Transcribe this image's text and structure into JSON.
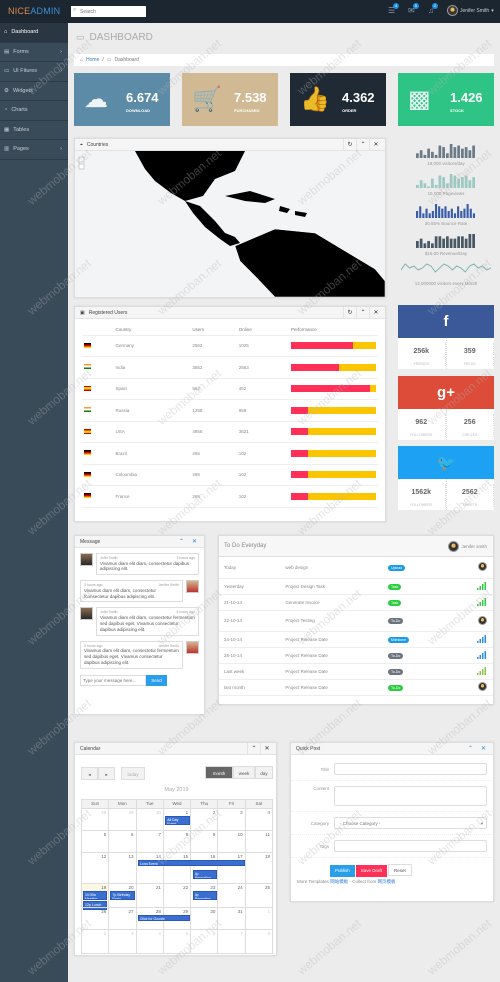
{
  "header": {
    "logo_a": "NICE",
    "logo_b": "ADMIN",
    "search_placeholder": "Search",
    "badges": [
      "4",
      "5",
      "2"
    ],
    "user": "Jenifer Smith"
  },
  "sidebar": {
    "items": [
      {
        "label": "Dashboard",
        "icon": "home-icon",
        "active": true
      },
      {
        "label": "Forms",
        "icon": "document-icon",
        "chevron": true
      },
      {
        "label": "UI Fitures",
        "icon": "monitor-icon",
        "chevron": true
      },
      {
        "label": "Widgets",
        "icon": "gear-icon"
      },
      {
        "label": "Charts",
        "icon": "pie-icon"
      },
      {
        "label": "Tables",
        "icon": "table-icon"
      },
      {
        "label": "Pages",
        "icon": "page-icon",
        "chevron": true
      }
    ]
  },
  "page": {
    "title": "DASHBOARD",
    "breadcrumb": [
      "Home",
      "Dashboard"
    ]
  },
  "stats": [
    {
      "value": "6.674",
      "label": "DOWNLOAD",
      "color": "#5b8ba6",
      "icon": "cloud-download-icon"
    },
    {
      "value": "7.538",
      "label": "PURCHASED",
      "color": "#d1b993",
      "icon": "cart-icon"
    },
    {
      "value": "4.362",
      "label": "ORDER",
      "color": "#1f2a35",
      "icon": "thumbs-up-icon"
    },
    {
      "value": "1.426",
      "label": "STOCK",
      "color": "#2ec486",
      "icon": "cubes-icon"
    }
  ],
  "countries_panel": {
    "title": "Countries"
  },
  "sparklines": [
    {
      "label": "19,000 visitors/day",
      "color": "#6b7c88",
      "values": [
        3,
        5,
        2,
        6,
        4,
        2,
        8,
        7,
        3,
        9,
        7,
        8,
        6,
        7,
        5,
        8
      ]
    },
    {
      "label": "15,000 Pageviews",
      "color": "#9cc9c4",
      "values": [
        2,
        5,
        3,
        1,
        6,
        2,
        8,
        7,
        3,
        9,
        8,
        6,
        7,
        8,
        5,
        7
      ]
    },
    {
      "label": "30.55% Bounce Rate",
      "color": "#3b5da8",
      "values": [
        3,
        5,
        2,
        4,
        2,
        3,
        6,
        5,
        4,
        5,
        3,
        4,
        2,
        5,
        3,
        4,
        6,
        4,
        2
      ]
    },
    {
      "label": "$16.00 Revenue/Day",
      "color": "#4a5866",
      "values": [
        3,
        4,
        2,
        3,
        2,
        5,
        5,
        4,
        5,
        4,
        4,
        5,
        5,
        4,
        6,
        6
      ]
    },
    {
      "label": "12,000000 visitors every Month",
      "color": "#7fb5b0",
      "values": [
        3,
        6,
        4,
        5,
        3,
        4,
        6,
        5,
        2,
        4,
        6,
        5,
        3,
        5,
        4,
        2,
        5,
        6,
        4,
        5,
        3,
        4
      ]
    }
  ],
  "users_panel": {
    "title": "Registered Users",
    "columns": [
      "Country",
      "Users",
      "Online",
      "Performance"
    ],
    "rows": [
      {
        "flag": "de",
        "country": "Germany",
        "users": "2563",
        "online": "1025",
        "perf": 0.73
      },
      {
        "flag": "in",
        "country": "India",
        "users": "3652",
        "online": "2563",
        "perf": 0.57
      },
      {
        "flag": "es",
        "country": "Spain",
        "users": "562",
        "online": "452",
        "perf": 0.93
      },
      {
        "flag": "in",
        "country": "Russia",
        "users": "1258",
        "online": "958",
        "perf": 0.2
      },
      {
        "flag": "es",
        "country": "USA",
        "users": "4856",
        "online": "3621",
        "perf": 0.2
      },
      {
        "flag": "de",
        "country": "Brazil",
        "users": "265",
        "online": "102",
        "perf": 0.2
      },
      {
        "flag": "de",
        "country": "Coloumbia",
        "users": "265",
        "online": "102",
        "perf": 0.2
      },
      {
        "flag": "de",
        "country": "France",
        "users": "265",
        "online": "102",
        "perf": 0.2
      }
    ]
  },
  "social": [
    {
      "icon": "facebook-icon",
      "glyph": "f",
      "color": "#3b5998",
      "a": "256k",
      "al": "FRIENDS",
      "b": "359",
      "bl": "FEEDS"
    },
    {
      "icon": "google-plus-icon",
      "glyph": "g+",
      "color": "#dd4b39",
      "a": "962",
      "al": "FOLLOWERS",
      "b": "256",
      "bl": "CIRCLES"
    },
    {
      "icon": "twitter-icon",
      "glyph": "🐦",
      "color": "#1da1f2",
      "a": "1562k",
      "al": "FOLLOWERS",
      "b": "2562",
      "bl": "TWEETS"
    }
  ],
  "messages": {
    "title": "Message",
    "items": [
      {
        "side": "left",
        "name": "John Smith",
        "time": "3 hours ago",
        "text": "Vivamus diam elit diam, consectetur dapibus adipiscing elit."
      },
      {
        "side": "right",
        "name": "Jenifer Smith",
        "time": "3 hours ago",
        "text": "Vivamus diam elit diam, consectetur fconsectetur dapibus adipiscing elit."
      },
      {
        "side": "left",
        "name": "John Smith",
        "time": "4 hours ago",
        "text": "Vivamus diam elit diam, consectetur fermentum sed dapibus eget, Vivamus consectetur dapibus adipiscing elit."
      },
      {
        "side": "right",
        "name": "Jenifer Smith",
        "time": "3 hours ago",
        "text": "Vivamus diam elit diam, consectetur fermentum sed dapibus eget, Vivamus consectetur dapibus adipiscing elit."
      }
    ],
    "input_placeholder": "Type your message here...",
    "send": "Send"
  },
  "todo": {
    "title": "To Do Everyday",
    "user": "Jenifer smith",
    "rows": [
      {
        "when": "Today",
        "task": "web design",
        "badge": "Upload",
        "color": "#1a9be6",
        "end": "avatar"
      },
      {
        "when": "Yesterday",
        "task": "Project Design Task",
        "badge": "Task",
        "color": "#2ecc40",
        "end": "green-bars"
      },
      {
        "when": "21-10-14",
        "task": "Generate Invoice",
        "badge": "Task",
        "color": "#2ecc40",
        "end": "green-bars"
      },
      {
        "when": "22-10-14",
        "task": "Project Testing",
        "badge": "To-Do",
        "color": "#6c757d",
        "end": "avatar"
      },
      {
        "when": "24-10-14",
        "task": "Project Release Date",
        "badge": "Milestone",
        "color": "#1a9be6",
        "end": "blue-bars"
      },
      {
        "when": "28-10-14",
        "task": "Project Release Date",
        "badge": "To-Do",
        "color": "#6c757d",
        "end": "blue-bars"
      },
      {
        "when": "Last week",
        "task": "Project Release Date",
        "badge": "To-Do",
        "color": "#6c757d",
        "end": "olive-bars"
      },
      {
        "when": "last month",
        "task": "Project Release Date",
        "badge": "To-Do",
        "color": "#2ecc40",
        "end": "avatar"
      }
    ]
  },
  "calendar": {
    "title": "Calendar",
    "prev": "◂",
    "next": "▸",
    "today": "today",
    "views": [
      "month",
      "week",
      "day"
    ],
    "active_view": "month",
    "month": "May 2019",
    "days": [
      "Sun",
      "Mon",
      "Tue",
      "Wed",
      "Thu",
      "Fri",
      "Sat"
    ],
    "weeks": [
      [
        28,
        29,
        30,
        1,
        2,
        3,
        4
      ],
      [
        5,
        6,
        7,
        8,
        9,
        10,
        11
      ],
      [
        12,
        13,
        14,
        15,
        16,
        17,
        18
      ],
      [
        19,
        20,
        21,
        22,
        23,
        24,
        25
      ],
      [
        26,
        27,
        28,
        29,
        30,
        31,
        1
      ],
      [
        2,
        3,
        4,
        5,
        6,
        7,
        8
      ]
    ],
    "today_cell": [
      3,
      0
    ],
    "events": [
      {
        "title": "All Day Event",
        "week": 0,
        "from": 3,
        "to": 3,
        "slot": 0
      },
      {
        "title": "Long Event",
        "week": 2,
        "from": 2,
        "to": 5,
        "slot": 0
      },
      {
        "title": "4p Repeating Event",
        "week": 2,
        "from": 4,
        "to": 4,
        "slot": 1
      },
      {
        "title": "10:30a Meeting",
        "week": 3,
        "from": 0,
        "to": 0,
        "slot": 0
      },
      {
        "title": "12p Lunch",
        "week": 3,
        "from": 0,
        "to": 0,
        "slot": 1
      },
      {
        "title": "7p Birthday Party",
        "week": 3,
        "from": 1,
        "to": 1,
        "slot": 0
      },
      {
        "title": "4p Repeating Event",
        "week": 3,
        "from": 4,
        "to": 4,
        "slot": 0
      },
      {
        "title": "Click for Google",
        "week": 4,
        "from": 2,
        "to": 3,
        "slot": 0
      }
    ]
  },
  "quickpost": {
    "title": "Quick Post",
    "fields": [
      {
        "label": "Title",
        "value": ""
      },
      {
        "label": "Content",
        "value": ""
      },
      {
        "label": "Category",
        "value": "- Choose Category -"
      },
      {
        "label": "Tags",
        "value": ""
      }
    ],
    "buttons": [
      "Publish",
      "Save Draft",
      "Reset"
    ],
    "footer_a": "More Templates",
    "footer_link_a": "网站模板",
    "footer_b": "- Collect from",
    "footer_link_b": "网页模板"
  }
}
